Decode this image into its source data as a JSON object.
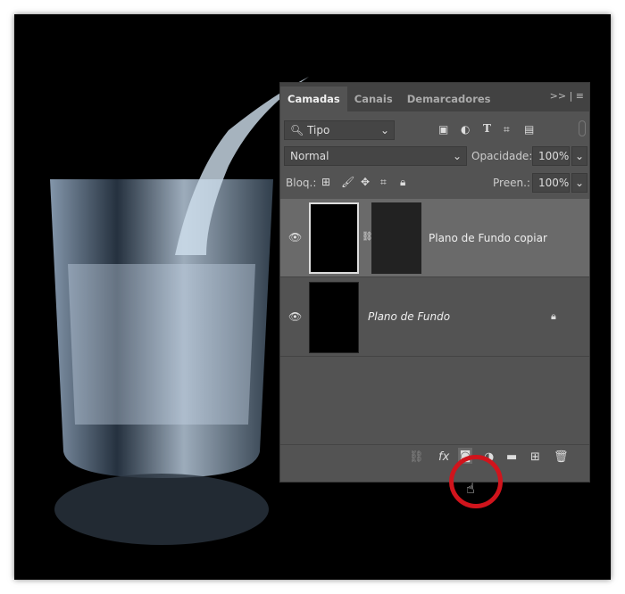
{
  "tabs": [
    {
      "label": "Camadas",
      "active": true
    },
    {
      "label": "Canais"
    },
    {
      "label": "Demarcadores"
    }
  ],
  "tab_menu": ">>  |  ≡",
  "filter": {
    "value": "Tipo",
    "icons": [
      "image-filter-icon",
      "adjustment-filter-icon",
      "type-filter-icon",
      "shape-filter-icon",
      "smart-object-filter-icon"
    ]
  },
  "blend": {
    "mode": "Normal",
    "opacity_label": "Opacidade:",
    "opacity": "100%"
  },
  "lock": {
    "label": "Bloq.:",
    "fill_label": "Preen.:",
    "fill": "100%"
  },
  "layers": [
    {
      "name": "Plano de Fundo copiar",
      "visible": true,
      "selected": true,
      "has_mask": true
    },
    {
      "name": "Plano de Fundo",
      "visible": true,
      "locked": true,
      "italic": true
    }
  ],
  "footer_icons": [
    "link-icon",
    "fx-icon",
    "add-mask-icon",
    "adjustment-icon",
    "folder-icon",
    "new-layer-icon",
    "trash-icon"
  ],
  "highlight_color": "#d0141c"
}
